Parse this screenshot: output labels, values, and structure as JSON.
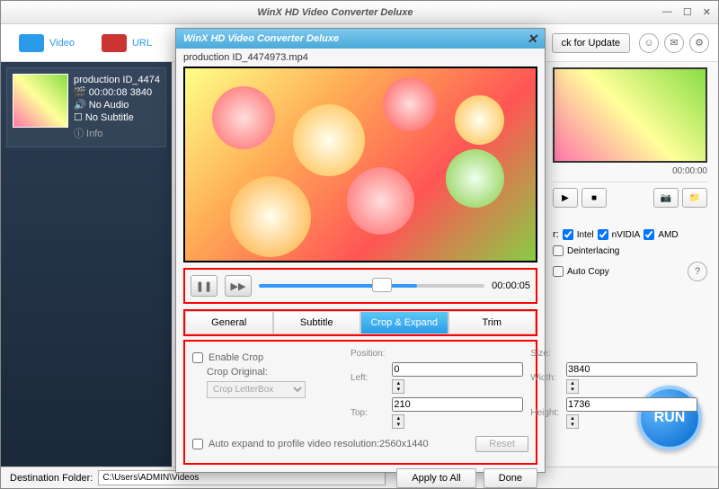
{
  "window": {
    "title": "WinX HD Video Converter Deluxe"
  },
  "toolbar": {
    "video": "Video",
    "url": "URL",
    "update": "ck for Update"
  },
  "sidebar": {
    "item": {
      "filename": "production ID_4474",
      "duration": "00:00:08",
      "res": "3840",
      "audio": "No Audio",
      "subtitle": "No Subtitle",
      "info": "Info"
    }
  },
  "preview": {
    "time": "00:00:00"
  },
  "hw": {
    "label": "r:",
    "intel": "Intel",
    "nvidia": "nVIDIA",
    "amd": "AMD",
    "deint": "Deinterlacing",
    "autocopy": "Auto Copy"
  },
  "run": "RUN",
  "footer": {
    "label": "Destination Folder:",
    "path": "C:\\Users\\ADMIN\\Videos"
  },
  "modal": {
    "title": "WinX HD Video Converter Deluxe",
    "filename": "production ID_4474973.mp4",
    "time": "00:00:05",
    "tabs": {
      "general": "General",
      "subtitle": "Subtitle",
      "crop": "Crop & Expand",
      "trim": "Trim"
    },
    "crop": {
      "enable": "Enable Crop",
      "original": "Crop Original:",
      "original_val": "Crop LetterBox",
      "position": "Position:",
      "size": "Size:",
      "left_lbl": "Left:",
      "left": "0",
      "top_lbl": "Top:",
      "top": "210",
      "width_lbl": "Width:",
      "width": "3840",
      "height_lbl": "Height:",
      "height": "1736",
      "autoexpand": "Auto expand to profile video resolution:2560x1440",
      "reset": "Reset"
    },
    "apply": "Apply to All",
    "done": "Done"
  }
}
